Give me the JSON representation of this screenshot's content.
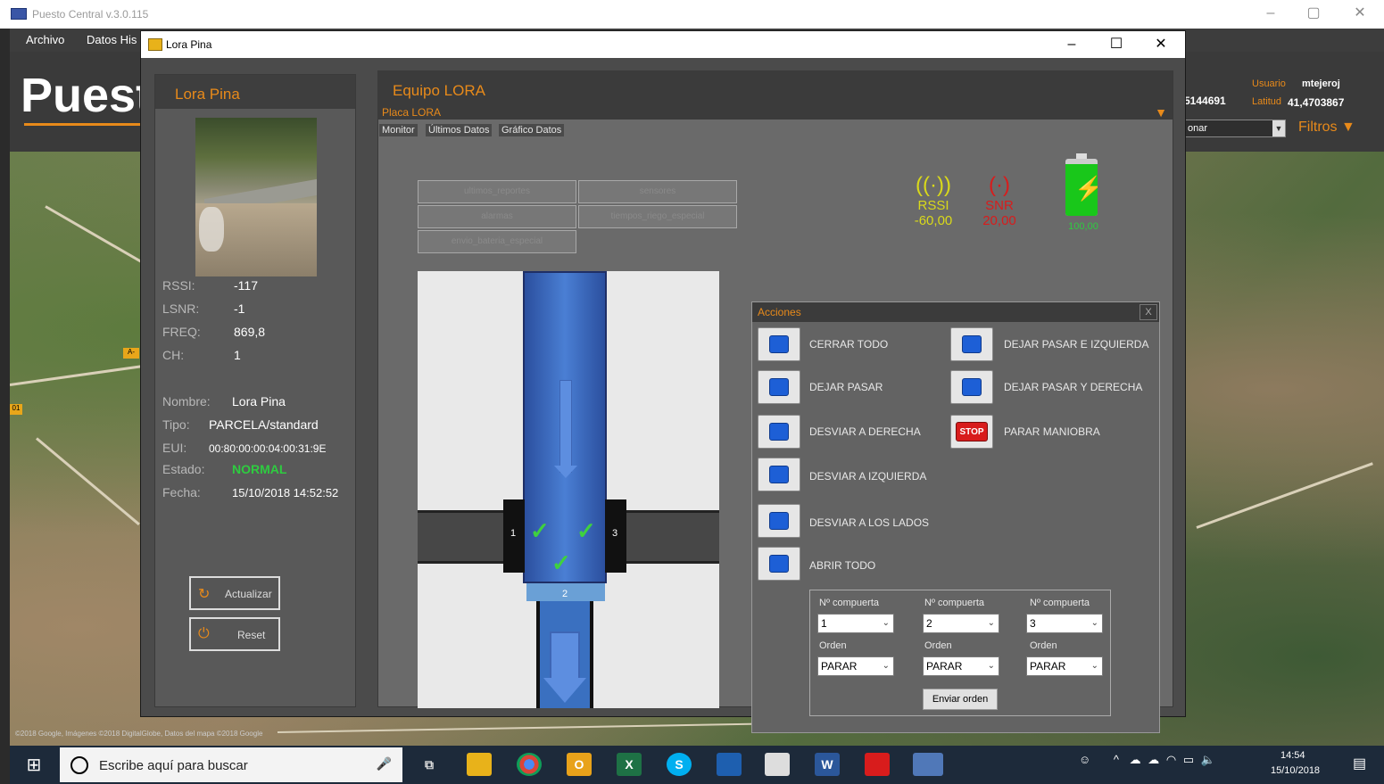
{
  "main_window": {
    "title": "Puesto Central v.3.0.115",
    "menu": [
      "Archivo",
      "Datos His"
    ],
    "brand": "Puest",
    "right_info": {
      "coord_partial": "5144691",
      "user_label": "Usuario",
      "user_value": "mtejeroj",
      "lat_label": "Latitud",
      "lat_value": "41,4703867",
      "combo_value": "onar",
      "filtros": "Filtros"
    },
    "map_credit": "©2018 Google, Imágenes ©2018 DigitalGlobe, Datos del mapa ©2018 Google",
    "road_labels": [
      "A-",
      "01"
    ]
  },
  "taskbar": {
    "search_placeholder": "Escribe aquí para buscar",
    "apps": [
      "task-view",
      "file-explorer",
      "chrome",
      "outlook",
      "excel",
      "skype",
      "app",
      "photos",
      "word",
      "acrobat",
      "puesto-central"
    ],
    "clock_time": "14:54",
    "clock_date": "15/10/2018"
  },
  "dialog": {
    "title": "Lora Pina",
    "left_panel": {
      "title": "Lora Pina",
      "radio": [
        {
          "key": "RSSI:",
          "value": "-117"
        },
        {
          "key": "LSNR:",
          "value": "-1"
        },
        {
          "key": "FREQ:",
          "value": "869,8"
        },
        {
          "key": "CH:",
          "value": "1"
        }
      ],
      "info": {
        "nombre_label": "Nombre:",
        "nombre": "Lora Pina",
        "tipo_label": "Tipo:",
        "tipo": "PARCELA/standard",
        "eui_label": "EUI:",
        "eui": "00:80:00:00:04:00:31:9E",
        "estado_label": "Estado:",
        "estado": "NORMAL",
        "fecha_label": "Fecha:",
        "fecha": "15/10/2018 14:52:52"
      },
      "btn_actualizar": "Actualizar",
      "btn_reset": "Reset"
    },
    "right_panel": {
      "title": "Equipo LORA",
      "subtitle": "Placa LORA",
      "tabs": [
        "Monitor",
        "Últimos Datos",
        "Gráfico Datos"
      ],
      "gray_buttons": [
        "ultimos_reportes",
        "sensores",
        "alarmas",
        "tiempos_riego_especial",
        "envio_bateria_especial"
      ],
      "signal": {
        "rssi_label": "RSSI",
        "rssi_value": "-60,00",
        "snr_label": "SNR",
        "snr_value": "20,00",
        "battery_value": "100,00",
        "battery_level": 0.9
      },
      "diagram": {
        "gates": [
          "1",
          "2",
          "3"
        ]
      },
      "acciones": {
        "title": "Acciones",
        "close": "X",
        "items": [
          {
            "label": "CERRAR TODO",
            "icon": "gate-closed-icon"
          },
          {
            "label": "DEJAR PASAR",
            "icon": "gate-pass-icon"
          },
          {
            "label": "DESVIAR A DERECHA",
            "icon": "divert-right-icon"
          },
          {
            "label": "DESVIAR A IZQUIERDA",
            "icon": "divert-left-icon"
          },
          {
            "label": "DESVIAR A LOS LADOS",
            "icon": "divert-sides-icon"
          },
          {
            "label": "ABRIR TODO",
            "icon": "open-all-icon"
          },
          {
            "label": "DEJAR PASAR E IZQUIERDA",
            "icon": "pass-left-icon"
          },
          {
            "label": "DEJAR PASAR Y DERECHA",
            "icon": "pass-right-icon"
          },
          {
            "label": "PARAR MANIOBRA",
            "icon": "stop-icon"
          }
        ],
        "stop_text": "STOP",
        "gate_label": "Nº compuerta",
        "order_label": "Orden",
        "gates": [
          {
            "gate": "1",
            "order": "PARAR"
          },
          {
            "gate": "2",
            "order": "PARAR"
          },
          {
            "gate": "3",
            "order": "PARAR"
          }
        ],
        "send": "Enviar orden"
      }
    }
  }
}
